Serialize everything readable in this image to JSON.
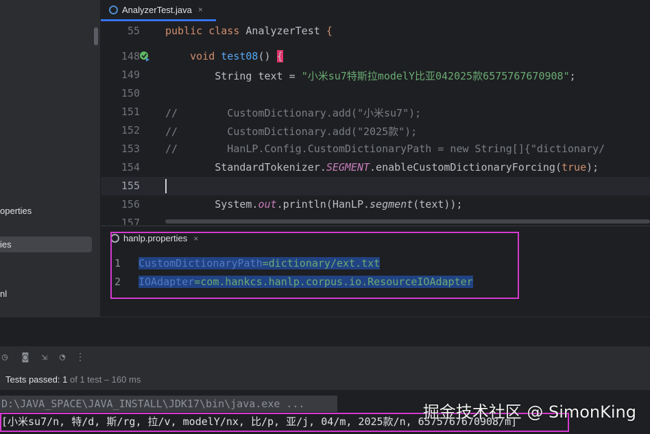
{
  "sidebar": {
    "items": [
      {
        "label": "operties"
      },
      {
        "label": "ies"
      },
      {
        "label": "nl"
      }
    ]
  },
  "editor_tab": {
    "label": "AnalyzerTest.java",
    "close": "×"
  },
  "editor": {
    "lines": [
      {
        "num": "55",
        "segments": [
          {
            "t": "public class ",
            "c": "kw"
          },
          {
            "t": "AnalyzerTest ",
            "c": ""
          },
          {
            "t": "{",
            "c": "kw"
          }
        ]
      },
      {
        "num": "148",
        "segments": [
          {
            "t": "    void ",
            "c": "kw"
          },
          {
            "t": "test08",
            "c": "fn"
          },
          {
            "t": "() ",
            "c": ""
          },
          {
            "t": "{",
            "c": "brace"
          }
        ]
      },
      {
        "num": "149",
        "segments": [
          {
            "t": "        String text = ",
            "c": ""
          },
          {
            "t": "\"小米su7特斯拉modelY比亚042025款6575767670908\"",
            "c": "str"
          },
          {
            "t": ";",
            "c": ""
          }
        ]
      },
      {
        "num": "150",
        "segments": []
      },
      {
        "num": "151",
        "segments": [
          {
            "t": "//        CustomDictionary.add(\"小米su7\");",
            "c": "cmt"
          }
        ]
      },
      {
        "num": "152",
        "segments": [
          {
            "t": "//        CustomDictionary.add(\"2025款\");",
            "c": "cmt"
          }
        ]
      },
      {
        "num": "153",
        "segments": [
          {
            "t": "//        HanLP.Config.CustomDictionaryPath = new String[]{\"dictionary/",
            "c": "cmt"
          }
        ]
      },
      {
        "num": "154",
        "segments": [
          {
            "t": "        StandardTokenizer.",
            "c": ""
          },
          {
            "t": "SEGMENT",
            "c": "it"
          },
          {
            "t": ".enableCustomDictionaryForcing(",
            "c": ""
          },
          {
            "t": "true",
            "c": "kw"
          },
          {
            "t": ");",
            "c": ""
          }
        ]
      },
      {
        "num": "155",
        "segments": []
      },
      {
        "num": "156",
        "segments": [
          {
            "t": "        System.",
            "c": ""
          },
          {
            "t": "out",
            "c": "it"
          },
          {
            "t": ".println(HanLP.",
            "c": ""
          },
          {
            "t": "segment",
            "c": "it2"
          },
          {
            "t": "(text));",
            "c": ""
          }
        ]
      },
      {
        "num": "157",
        "segments": []
      }
    ]
  },
  "props_tab": {
    "label": "hanlp.properties",
    "close": "×"
  },
  "props": {
    "lines": [
      {
        "num": "1",
        "key": "CustomDictionaryPath",
        "eq": "=",
        "value": "dictionary/ext.txt"
      },
      {
        "num": "2",
        "key": "IOAdapter",
        "eq": "=",
        "value": "com.hankcs.hanlp.corpus.io.ResourceIOAdapter"
      }
    ]
  },
  "tests": {
    "passed": "Tests passed:",
    "count": "1",
    "rest": "of 1 test – 160 ms"
  },
  "console": {
    "command": "D:\\JAVA_SPACE\\JAVA_INSTALL\\JDK17\\bin\\java.exe ...",
    "output": "[小米su7/n, 特/d, 斯/rg, 拉/v, modelY/nx, 比/p, 亚/j, 04/m, 2025款/n, 6575767670908/m]"
  },
  "watermark": "掘金技术社区 @ SimonKing"
}
